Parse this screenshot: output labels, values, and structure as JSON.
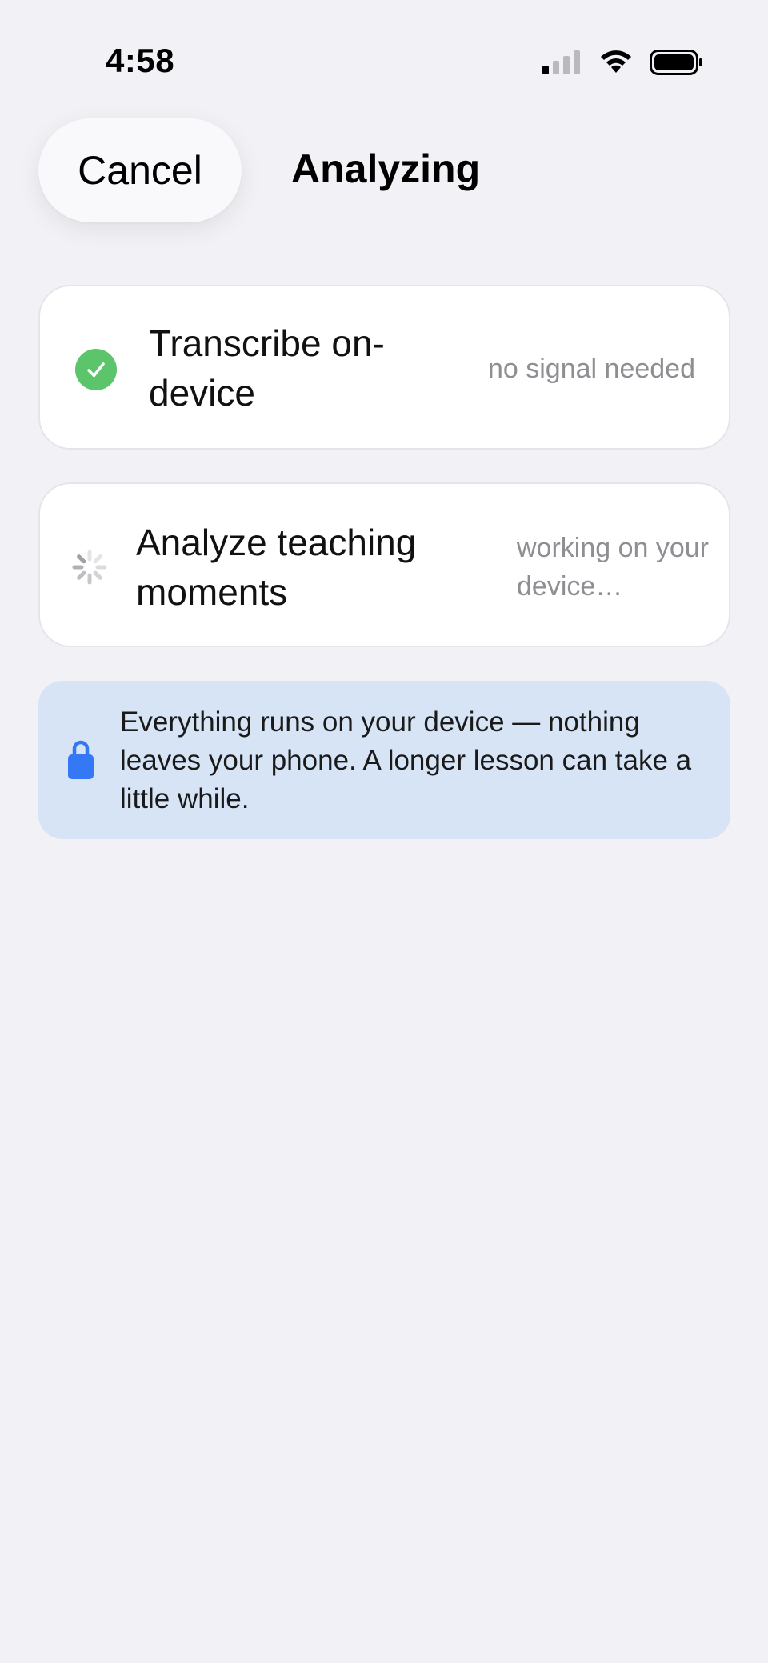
{
  "status_bar": {
    "time": "4:58",
    "icons": [
      "cellular-signal-icon",
      "wifi-icon",
      "battery-icon"
    ]
  },
  "nav": {
    "cancel_label": "Cancel",
    "title": "Analyzing"
  },
  "steps": [
    {
      "title": "Transcribe on-device",
      "status": "no signal needed",
      "state": "complete",
      "icon": "checkmark-circle-icon"
    },
    {
      "title": "Analyze teaching moments",
      "status": "working on your device…",
      "state": "in-progress",
      "icon": "spinner-icon"
    }
  ],
  "info_banner": {
    "icon": "lock-icon",
    "text": "Everything runs on your device — nothing leaves your phone. A longer lesson can take a little while."
  },
  "colors": {
    "background": "#f1f1f6",
    "card": "#ffffff",
    "success": "#5cc46a",
    "accent": "#3478f6",
    "banner": "#d6e4f6",
    "secondary_text": "#8e8e93"
  }
}
